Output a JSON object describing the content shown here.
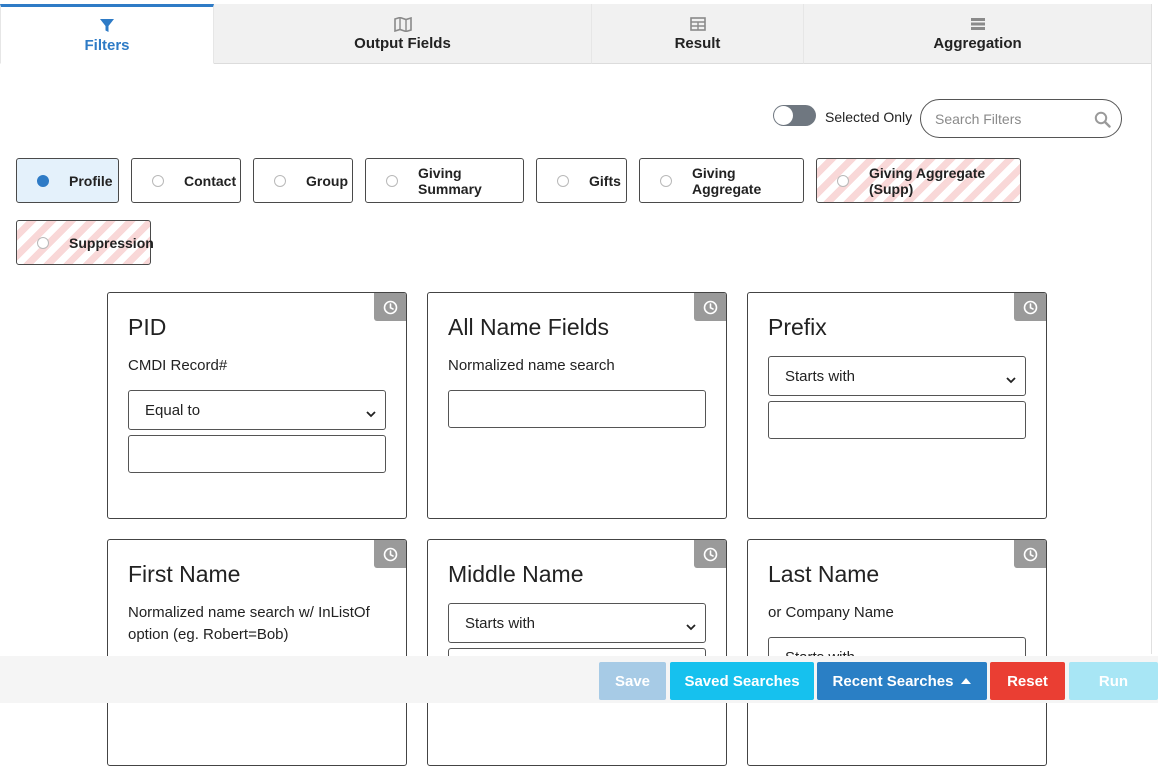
{
  "tabs": [
    {
      "label": "Filters",
      "icon": "filter-icon"
    },
    {
      "label": "Output Fields",
      "icon": "map-icon"
    },
    {
      "label": "Result",
      "icon": "table-icon"
    },
    {
      "label": "Aggregation",
      "icon": "list-icon"
    }
  ],
  "toolbar": {
    "selected_only_label": "Selected Only",
    "selected_only_on": false,
    "search_placeholder": "Search Filters",
    "search_value": ""
  },
  "categories": [
    {
      "label": "Profile",
      "active": true
    },
    {
      "label": "Contact"
    },
    {
      "label": "Group"
    },
    {
      "label": "Giving Summary"
    },
    {
      "label": "Gifts"
    },
    {
      "label": "Giving Aggregate"
    },
    {
      "label": "Giving Aggregate (Supp)",
      "striped": true
    },
    {
      "label": "Suppression",
      "striped": true
    }
  ],
  "cards": [
    {
      "title": "PID",
      "desc": "CMDI Record#",
      "operator": "Equal to",
      "value": ""
    },
    {
      "title": "All Name Fields",
      "desc": "Normalized name search",
      "value": ""
    },
    {
      "title": "Prefix",
      "desc": "",
      "operator": "Starts with",
      "value": ""
    },
    {
      "title": "First Name",
      "desc": "Normalized name search w/ InListOf option (eg. Robert=Bob)"
    },
    {
      "title": "Middle Name",
      "desc": "",
      "operator": "Starts with"
    },
    {
      "title": "Last Name",
      "desc": "or Company Name",
      "operator": "Starts with"
    }
  ],
  "footer": {
    "save_label": "Save",
    "saved_searches_label": "Saved Searches",
    "recent_searches_label": "Recent Searches",
    "reset_label": "Reset",
    "run_label": "Run"
  },
  "colors": {
    "accent": "#2e7bc6",
    "save": "#a7cbe6",
    "saved_searches": "#16c1ee",
    "recent_searches": "#2a7fc5",
    "reset": "#ea3e33",
    "run": "#a8e6f5",
    "history_badge": "#9a9a9a"
  }
}
